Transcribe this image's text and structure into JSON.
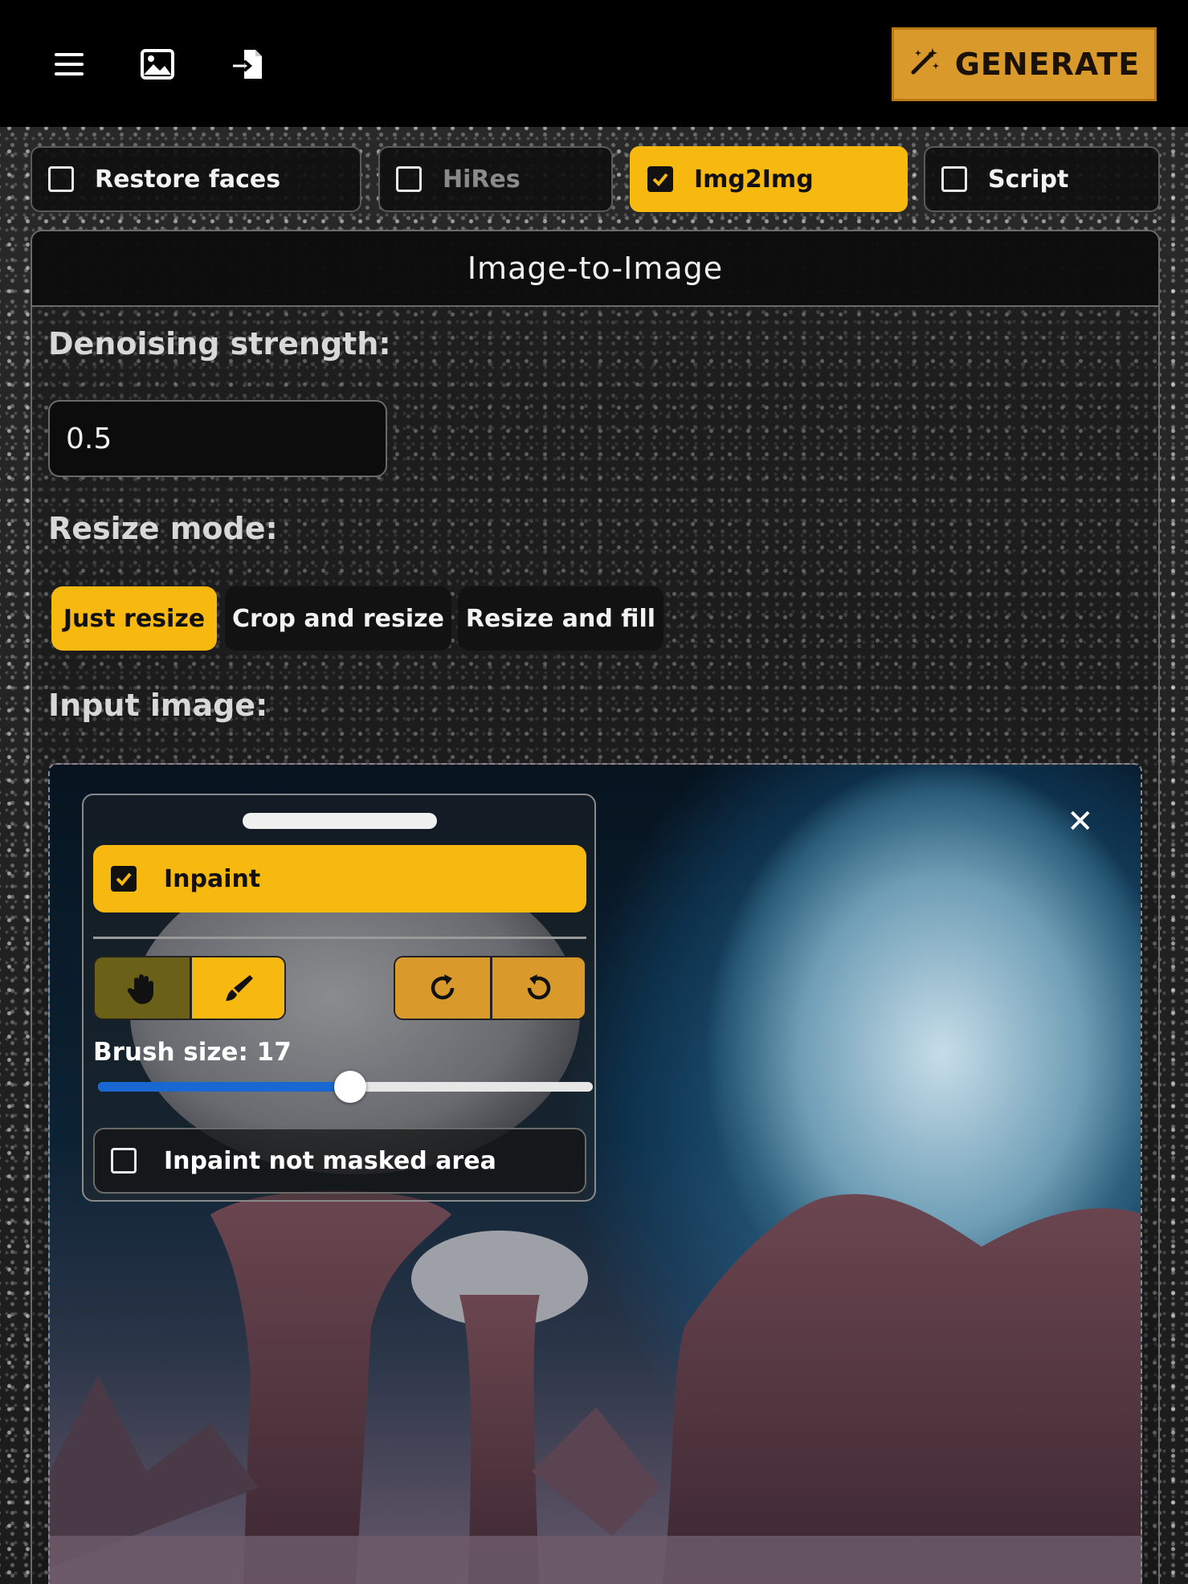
{
  "topbar": {
    "menu_icon": "hamburger-menu-icon",
    "image_icon": "image-icon",
    "import_icon": "file-import-icon",
    "generate_label": "GENERATE",
    "generate_icon": "magic-wand-icon",
    "accent": "#d99a2b"
  },
  "options": [
    {
      "label": "Restore faces",
      "checked": false
    },
    {
      "label": "HiRes",
      "checked": false
    },
    {
      "label": "Img2Img",
      "checked": true
    },
    {
      "label": "Script",
      "checked": false
    }
  ],
  "panel": {
    "title": "Image-to-Image",
    "denoising_label": "Denoising strength:",
    "denoising_value": "0.5",
    "resize_label": "Resize mode:",
    "resize_modes": [
      "Just resize",
      "Crop and resize",
      "Resize and fill"
    ],
    "resize_selected": "Just resize",
    "input_image_label": "Input image:",
    "close_icon": "close-icon"
  },
  "inpaint": {
    "toggle_label": "Inpaint",
    "toggle_checked": true,
    "tools": [
      "hand-pan-icon",
      "brush-icon"
    ],
    "history": [
      "redo-icon",
      "undo-icon"
    ],
    "brush_label": "Brush size: 17",
    "brush_fraction": 0.51,
    "not_masked_label": "Inpaint not masked area",
    "not_masked_checked": false
  },
  "colors": {
    "yellow": "#f7b90f",
    "orange": "#d99a2b",
    "slider": "#1967d2"
  }
}
